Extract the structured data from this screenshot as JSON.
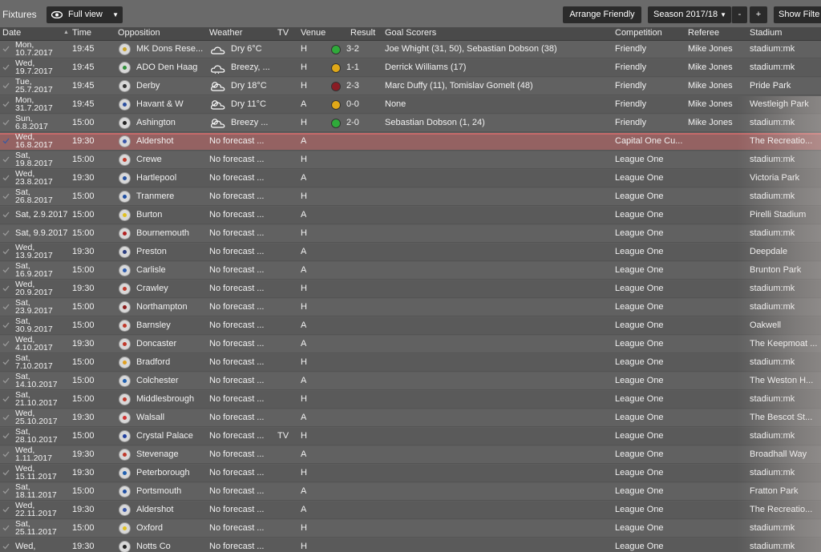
{
  "topbar": {
    "title": "Fixtures",
    "view_label": "Full view",
    "arrange_label": "Arrange Friendly",
    "season_label": "Season 2017/18",
    "minus_label": "-",
    "plus_label": "+",
    "show_filter_label": "Show Filte"
  },
  "columns": {
    "date": "Date",
    "time": "Time",
    "opposition": "Opposition",
    "weather": "Weather",
    "tv": "TV",
    "venue": "Venue",
    "result": "Result",
    "scorers": "Goal Scorers",
    "competition": "Competition",
    "referee": "Referee",
    "stadium": "Stadium"
  },
  "fixtures": [
    {
      "date1": "Mon,",
      "date2": "10.7.2017",
      "time": "19:45",
      "opp": "MK Dons Rese...",
      "weather": "Dry 6°C",
      "wicon": "cloud-icon",
      "tv": "",
      "venue": "H",
      "result": "3-2",
      "outcome": "win",
      "scorers": "Joe Whight (31, 50), Sebastian Dobson (38)",
      "comp": "Friendly",
      "ref": "Mike Jones",
      "stadium": "stadium:mk",
      "crest": "#c9a227"
    },
    {
      "date1": "Wed,",
      "date2": "19.7.2017",
      "time": "19:45",
      "opp": "ADO Den Haag",
      "weather": "Breezy, ...",
      "wicon": "rain-cloud-icon",
      "tv": "",
      "venue": "H",
      "result": "1-1",
      "outcome": "draw",
      "scorers": "Derrick Williams (17)",
      "comp": "Friendly",
      "ref": "Mike Jones",
      "stadium": "stadium:mk",
      "crest": "#2f8f3a"
    },
    {
      "date1": "Tue,",
      "date2": "25.7.2017",
      "time": "19:45",
      "opp": "Derby",
      "weather": "Dry 18°C",
      "wicon": "sun-cloud-icon",
      "tv": "",
      "venue": "H",
      "result": "2-3",
      "outcome": "loss",
      "scorers": "Marc Duffy (11), Tomislav Gomelt (48)",
      "comp": "Friendly",
      "ref": "Mike Jones",
      "stadium": "Pride Park",
      "crest": "#333333"
    },
    {
      "date1": "Mon,",
      "date2": "31.7.2017",
      "time": "19:45",
      "opp": "Havant & W",
      "weather": "Dry 11°C",
      "wicon": "sun-cloud-icon",
      "tv": "",
      "venue": "A",
      "result": "0-0",
      "outcome": "draw",
      "scorers": "None",
      "comp": "Friendly",
      "ref": "Mike Jones",
      "stadium": "Westleigh Park",
      "crest": "#2b4fa0"
    },
    {
      "date1": "Sun,",
      "date2": "6.8.2017",
      "time": "15:00",
      "opp": "Ashington",
      "weather": "Breezy ...",
      "wicon": "sun-cloud-icon",
      "tv": "",
      "venue": "H",
      "result": "2-0",
      "outcome": "win",
      "scorers": "Sebastian Dobson (1, 24)",
      "comp": "Friendly",
      "ref": "Mike Jones",
      "stadium": "stadium:mk",
      "crest": "#222222"
    },
    {
      "date1": "Wed,",
      "date2": "16.8.2017",
      "time": "19:30",
      "opp": "Aldershot",
      "weather": "No forecast ...",
      "tv": "",
      "venue": "A",
      "result": "",
      "scorers": "",
      "comp": "Capital One Cu...",
      "ref": "",
      "stadium": "The Recreatio...",
      "crest": "#3a56a8",
      "highlight": true
    },
    {
      "date1": "Sat,",
      "date2": "19.8.2017",
      "time": "15:00",
      "opp": "Crewe",
      "weather": "No forecast ...",
      "tv": "",
      "venue": "H",
      "result": "",
      "scorers": "",
      "comp": "League One",
      "ref": "",
      "stadium": "stadium:mk",
      "crest": "#c0392b"
    },
    {
      "date1": "Wed,",
      "date2": "23.8.2017",
      "time": "19:30",
      "opp": "Hartlepool",
      "weather": "No forecast ...",
      "tv": "",
      "venue": "A",
      "result": "",
      "scorers": "",
      "comp": "League One",
      "ref": "",
      "stadium": "Victoria Park",
      "crest": "#2350a0"
    },
    {
      "date1": "Sat,",
      "date2": "26.8.2017",
      "time": "15:00",
      "opp": "Tranmere",
      "weather": "No forecast ...",
      "tv": "",
      "venue": "H",
      "result": "",
      "scorers": "",
      "comp": "League One",
      "ref": "",
      "stadium": "stadium:mk",
      "crest": "#1f4fa3"
    },
    {
      "date1": "Sat, 2.9.2017",
      "date2": "",
      "time": "15:00",
      "opp": "Burton",
      "weather": "No forecast ...",
      "tv": "",
      "venue": "A",
      "result": "",
      "scorers": "",
      "comp": "League One",
      "ref": "",
      "stadium": "Pirelli Stadium",
      "crest": "#e0c020"
    },
    {
      "date1": "Sat, 9.9.2017",
      "date2": "",
      "time": "15:00",
      "opp": "Bournemouth",
      "weather": "No forecast ...",
      "tv": "",
      "venue": "H",
      "result": "",
      "scorers": "",
      "comp": "League One",
      "ref": "",
      "stadium": "stadium:mk",
      "crest": "#b22222"
    },
    {
      "date1": "Wed,",
      "date2": "13.9.2017",
      "time": "19:30",
      "opp": "Preston",
      "weather": "No forecast ...",
      "tv": "",
      "venue": "A",
      "result": "",
      "scorers": "",
      "comp": "League One",
      "ref": "",
      "stadium": "Deepdale",
      "crest": "#2c3e80"
    },
    {
      "date1": "Sat,",
      "date2": "16.9.2017",
      "time": "15:00",
      "opp": "Carlisle",
      "weather": "No forecast ...",
      "tv": "",
      "venue": "A",
      "result": "",
      "scorers": "",
      "comp": "League One",
      "ref": "",
      "stadium": "Brunton Park",
      "crest": "#2e5db0"
    },
    {
      "date1": "Wed,",
      "date2": "20.9.2017",
      "time": "19:30",
      "opp": "Crawley",
      "weather": "No forecast ...",
      "tv": "",
      "venue": "H",
      "result": "",
      "scorers": "",
      "comp": "League One",
      "ref": "",
      "stadium": "stadium:mk",
      "crest": "#c0392b"
    },
    {
      "date1": "Sat,",
      "date2": "23.9.2017",
      "time": "15:00",
      "opp": "Northampton",
      "weather": "No forecast ...",
      "tv": "",
      "venue": "H",
      "result": "",
      "scorers": "",
      "comp": "League One",
      "ref": "",
      "stadium": "stadium:mk",
      "crest": "#8b1a1a"
    },
    {
      "date1": "Sat,",
      "date2": "30.9.2017",
      "time": "15:00",
      "opp": "Barnsley",
      "weather": "No forecast ...",
      "tv": "",
      "venue": "A",
      "result": "",
      "scorers": "",
      "comp": "League One",
      "ref": "",
      "stadium": "Oakwell",
      "crest": "#c0392b"
    },
    {
      "date1": "Wed,",
      "date2": "4.10.2017",
      "time": "19:30",
      "opp": "Doncaster",
      "weather": "No forecast ...",
      "tv": "",
      "venue": "A",
      "result": "",
      "scorers": "",
      "comp": "League One",
      "ref": "",
      "stadium": "The Keepmoat ...",
      "crest": "#c0392b"
    },
    {
      "date1": "Sat,",
      "date2": "7.10.2017",
      "time": "15:00",
      "opp": "Bradford",
      "weather": "No forecast ...",
      "tv": "",
      "venue": "H",
      "result": "",
      "scorers": "",
      "comp": "League One",
      "ref": "",
      "stadium": "stadium:mk",
      "crest": "#e0a020"
    },
    {
      "date1": "Sat,",
      "date2": "14.10.2017",
      "time": "15:00",
      "opp": "Colchester",
      "weather": "No forecast ...",
      "tv": "",
      "venue": "A",
      "result": "",
      "scorers": "",
      "comp": "League One",
      "ref": "",
      "stadium": "The Weston H...",
      "crest": "#2060b0"
    },
    {
      "date1": "Sat,",
      "date2": "21.10.2017",
      "time": "15:00",
      "opp": "Middlesbrough",
      "weather": "No forecast ...",
      "tv": "",
      "venue": "H",
      "result": "",
      "scorers": "",
      "comp": "League One",
      "ref": "",
      "stadium": "stadium:mk",
      "crest": "#c0392b"
    },
    {
      "date1": "Wed,",
      "date2": "25.10.2017",
      "time": "19:30",
      "opp": "Walsall",
      "weather": "No forecast ...",
      "tv": "",
      "venue": "A",
      "result": "",
      "scorers": "",
      "comp": "League One",
      "ref": "",
      "stadium": "The Bescot St...",
      "crest": "#d03030"
    },
    {
      "date1": "Sat,",
      "date2": "28.10.2017",
      "time": "15:00",
      "opp": "Crystal Palace",
      "weather": "No forecast ...",
      "tv": "TV",
      "venue": "H",
      "result": "",
      "scorers": "",
      "comp": "League One",
      "ref": "",
      "stadium": "stadium:mk",
      "crest": "#2040a0"
    },
    {
      "date1": "Wed,",
      "date2": "1.11.2017",
      "time": "19:30",
      "opp": "Stevenage",
      "weather": "No forecast ...",
      "tv": "",
      "venue": "A",
      "result": "",
      "scorers": "",
      "comp": "League One",
      "ref": "",
      "stadium": "Broadhall Way",
      "crest": "#c0392b"
    },
    {
      "date1": "Wed,",
      "date2": "15.11.2017",
      "time": "19:30",
      "opp": "Peterborough",
      "weather": "No forecast ...",
      "tv": "",
      "venue": "H",
      "result": "",
      "scorers": "",
      "comp": "League One",
      "ref": "",
      "stadium": "stadium:mk",
      "crest": "#2060b0"
    },
    {
      "date1": "Sat,",
      "date2": "18.11.2017",
      "time": "15:00",
      "opp": "Portsmouth",
      "weather": "No forecast ...",
      "tv": "",
      "venue": "A",
      "result": "",
      "scorers": "",
      "comp": "League One",
      "ref": "",
      "stadium": "Fratton Park",
      "crest": "#1f4fa3"
    },
    {
      "date1": "Wed,",
      "date2": "22.11.2017",
      "time": "19:30",
      "opp": "Aldershot",
      "weather": "No forecast ...",
      "tv": "",
      "venue": "A",
      "result": "",
      "scorers": "",
      "comp": "League One",
      "ref": "",
      "stadium": "The Recreatio...",
      "crest": "#3a56a8"
    },
    {
      "date1": "Sat,",
      "date2": "25.11.2017",
      "time": "15:00",
      "opp": "Oxford",
      "weather": "No forecast ...",
      "tv": "",
      "venue": "H",
      "result": "",
      "scorers": "",
      "comp": "League One",
      "ref": "",
      "stadium": "stadium:mk",
      "crest": "#e0c020"
    },
    {
      "date1": "Wed,",
      "date2": "",
      "time": "19:30",
      "opp": "Notts Co",
      "weather": "No forecast ...",
      "tv": "",
      "venue": "H",
      "result": "",
      "scorers": "",
      "comp": "League One",
      "ref": "",
      "stadium": "stadium:mk",
      "crest": "#222222"
    }
  ],
  "colors": {
    "win": "#2faa3a",
    "draw": "#e0a818",
    "loss": "#8a1c24",
    "highlight": "#946262"
  }
}
